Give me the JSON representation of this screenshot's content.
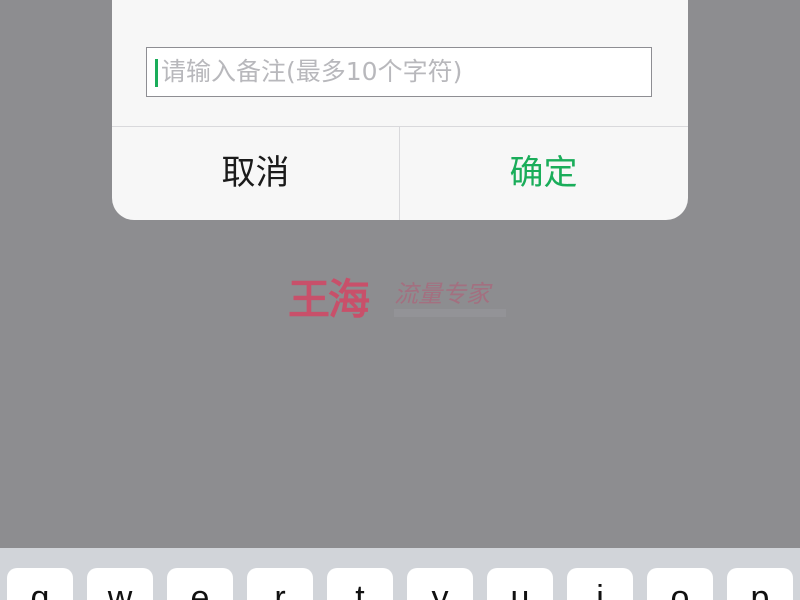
{
  "dialog": {
    "title": "",
    "note_input": {
      "value": "",
      "placeholder": "请输入备注(最多10个字符)"
    },
    "cancel_label": "取消",
    "confirm_label": "确定",
    "confirm_color": "#1aad5a"
  },
  "watermark": {
    "logo": "王海",
    "tagline": "流量专家"
  },
  "keyboard": {
    "row1": [
      "q",
      "w",
      "e",
      "r",
      "t",
      "y",
      "u",
      "i",
      "o",
      "p"
    ]
  },
  "colors": {
    "overlay": "#8d8d90",
    "dialog_bg": "#f7f7f7",
    "keyboard_bg": "#d1d4d9"
  }
}
